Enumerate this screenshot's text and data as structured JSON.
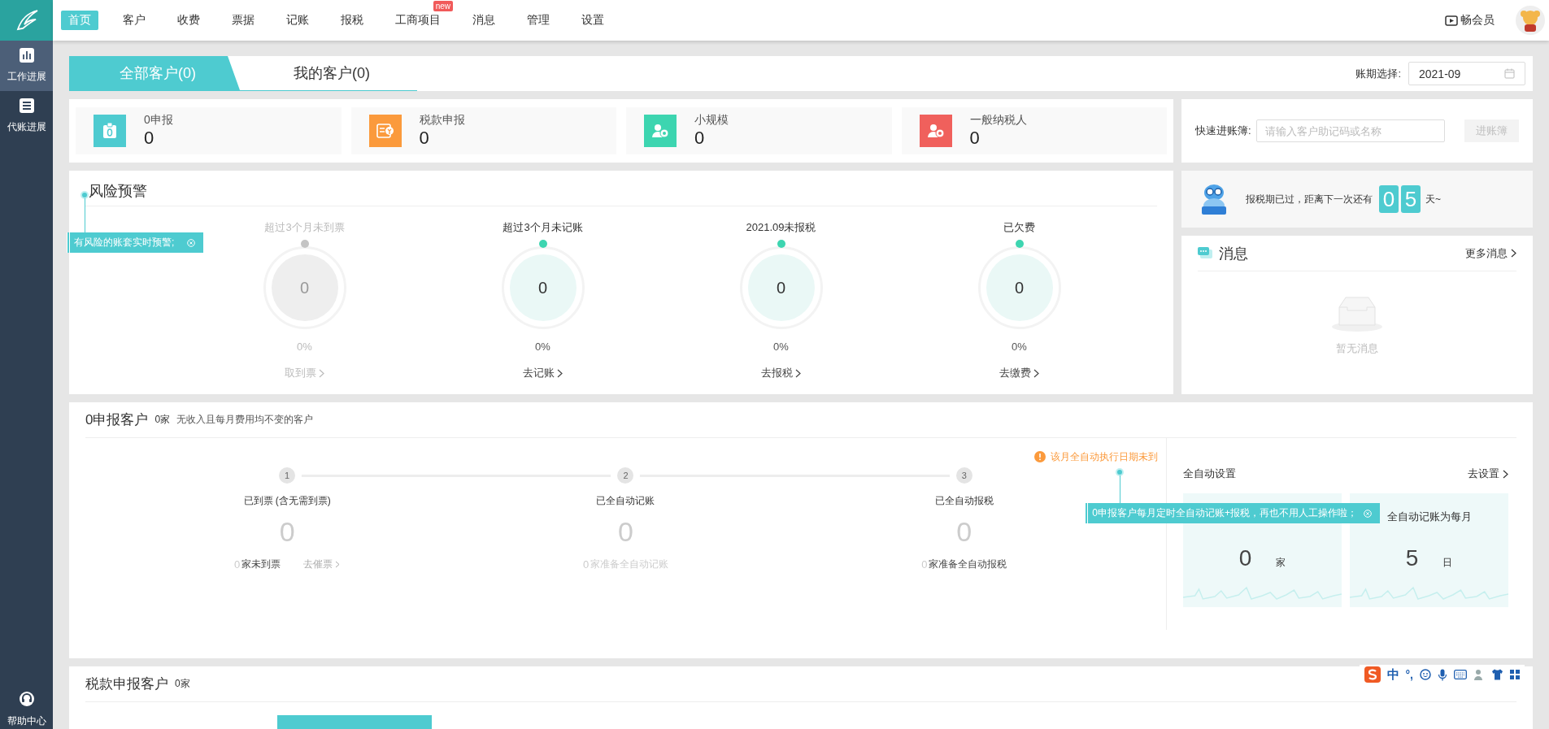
{
  "nav": {
    "items": [
      {
        "label": "首页",
        "selected": true
      },
      {
        "label": "客户",
        "selected": false
      },
      {
        "label": "收费",
        "selected": false
      },
      {
        "label": "票据",
        "selected": false
      },
      {
        "label": "记账",
        "selected": false
      },
      {
        "label": "报税",
        "selected": false
      },
      {
        "label": "工商项目",
        "selected": false,
        "badge": "new"
      },
      {
        "label": "消息",
        "selected": false
      },
      {
        "label": "管理",
        "selected": false
      },
      {
        "label": "设置",
        "selected": false
      }
    ],
    "member": "畅会员"
  },
  "sidebar": {
    "items": [
      {
        "label": "工作进展",
        "selected": true,
        "kind": "chart"
      },
      {
        "label": "代账进展",
        "selected": false,
        "kind": "list"
      }
    ],
    "help": "帮助中心"
  },
  "customer_tabs": [
    {
      "label": "全部客户(0)",
      "selected": true
    },
    {
      "label": "我的客户(0)",
      "selected": false
    }
  ],
  "period": {
    "label": "账期选择:",
    "value": "2021-09"
  },
  "stat_cards": [
    {
      "label": "0申报",
      "value": "0",
      "color": "#4ecbd0",
      "kind": "zero"
    },
    {
      "label": "税款申报",
      "value": "0",
      "color": "#fb9a3c",
      "kind": "tax"
    },
    {
      "label": "小规模",
      "value": "0",
      "color": "#3dd5b0",
      "kind": "small"
    },
    {
      "label": "一般纳税人",
      "value": "0",
      "color": "#f0605c",
      "kind": "general"
    }
  ],
  "quick_entry": {
    "label": "快速进账簿:",
    "placeholder": "请输入客户助记码或名称",
    "button": "进账簿",
    "disabled": true
  },
  "risk": {
    "title": "风险预警",
    "tooltip": "有风险的账套实时预警;",
    "items": [
      {
        "label": "超过3个月未到票",
        "value": "0",
        "percent": "0%",
        "link": "取到票",
        "disabled": true
      },
      {
        "label": "超过3个月未记账",
        "value": "0",
        "percent": "0%",
        "link": "去记账",
        "disabled": false
      },
      {
        "label": "2021.09未报税",
        "value": "0",
        "percent": "0%",
        "link": "去报税",
        "disabled": false
      },
      {
        "label": "已欠费",
        "value": "0",
        "percent": "0%",
        "link": "去缴费",
        "disabled": false
      }
    ]
  },
  "countdown": {
    "text": "报税期已过，距离下一次还有",
    "digits": [
      "0",
      "5"
    ],
    "unit": "天~"
  },
  "messages": {
    "title": "消息",
    "more": "更多消息",
    "empty": "暂无消息"
  },
  "zero_declare": {
    "title": "0申报客户",
    "count": "0家",
    "desc": "无收入且每月费用均不变的客户",
    "warning": "该月全自动执行日期未到",
    "tooltip": "0申报客户每月定时全自动记账+报税，再也不用人工操作啦；",
    "steps": [
      {
        "num": "1",
        "label": "已到票 (含无需到票)",
        "value": "0",
        "footer_count": "0",
        "footer_text": "家未到票",
        "link": "去催票",
        "muted": false
      },
      {
        "num": "2",
        "label": "已全自动记账",
        "value": "0",
        "footer_count": "0",
        "footer_text": "家准备全自动记账",
        "muted": true
      },
      {
        "num": "3",
        "label": "已全自动报税",
        "value": "0",
        "footer_count": "0",
        "footer_text": "家准备全自动报税",
        "muted": false
      }
    ],
    "auto": {
      "title": "全自动设置",
      "link": "去设置",
      "cards": [
        {
          "value": "0",
          "unit": "家"
        },
        {
          "label": "全自动记账为每月",
          "value": "5",
          "unit": "日"
        }
      ]
    }
  },
  "tax_declare": {
    "title": "税款申报客户",
    "count": "0家"
  },
  "ime": {
    "lang": "中",
    "punct": "°,"
  }
}
